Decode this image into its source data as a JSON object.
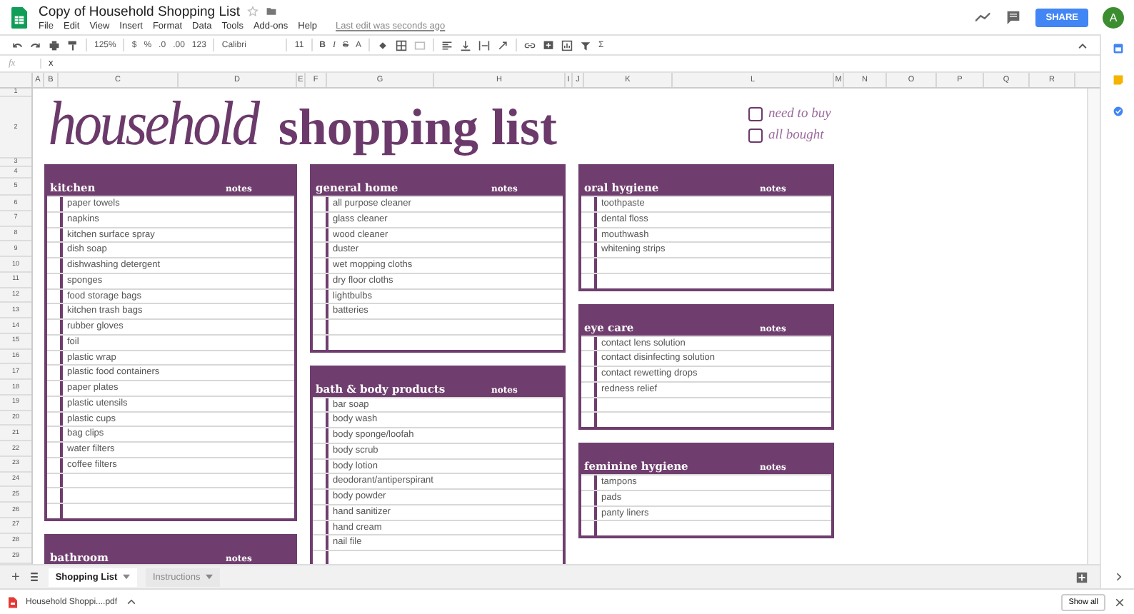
{
  "document": {
    "title": "Copy of Household Shopping List",
    "menu": [
      "File",
      "Edit",
      "View",
      "Insert",
      "Format",
      "Data",
      "Tools",
      "Add-ons",
      "Help"
    ],
    "last_edit": "Last edit was seconds ago"
  },
  "header_actions": {
    "share": "SHARE",
    "avatar": "A"
  },
  "toolbar": {
    "zoom": "125%",
    "currency": "$",
    "percent": "%",
    "decrease_decimals": ".0",
    "increase_decimals": ".00",
    "number_format": "123",
    "font": "Calibri",
    "font_size": "11",
    "format_buttons": [
      "B",
      "I",
      "S",
      "A"
    ],
    "sum": "Σ"
  },
  "formula_bar": {
    "label": "fx",
    "value": "x"
  },
  "column_headers": [
    "A",
    "B",
    "C",
    "D",
    "E",
    "F",
    "G",
    "H",
    "I",
    "J",
    "K",
    "L",
    "M",
    "N",
    "O",
    "P",
    "Q",
    "R"
  ],
  "row_headers": [
    "1",
    "2",
    "3",
    "4",
    "5",
    "6",
    "7",
    "8",
    "9",
    "10",
    "11",
    "12",
    "13",
    "14",
    "15",
    "16",
    "17",
    "18",
    "19",
    "20",
    "21",
    "22",
    "23",
    "24",
    "25",
    "26",
    "27",
    "28",
    "29"
  ],
  "sheet": {
    "title_script": "household",
    "title_bold": "shopping list",
    "legend": [
      {
        "label": "need to buy"
      },
      {
        "label": "all bought"
      }
    ],
    "columns": [
      [
        {
          "title": "kitchen",
          "notes": "notes",
          "items": [
            {
              "text": "paper towels",
              "checked": false
            },
            {
              "text": "napkins",
              "checked": false
            },
            {
              "text": "kitchen surface spray",
              "checked": false
            },
            {
              "text": "dish soap",
              "checked": false
            },
            {
              "text": "dishwashing detergent",
              "checked": false
            },
            {
              "text": "sponges",
              "checked": false
            },
            {
              "text": "food storage bags",
              "checked": false
            },
            {
              "text": "kitchen trash bags",
              "checked": false
            },
            {
              "text": "rubber gloves",
              "checked": false
            },
            {
              "text": "foil",
              "checked": false
            },
            {
              "text": "plastic wrap",
              "checked": false
            },
            {
              "text": "plastic food containers",
              "checked": false
            },
            {
              "text": "paper plates",
              "checked": false
            },
            {
              "text": "plastic utensils",
              "checked": false
            },
            {
              "text": "plastic cups",
              "checked": false
            },
            {
              "text": "bag clips",
              "checked": false
            },
            {
              "text": "water filters",
              "checked": false
            },
            {
              "text": "coffee filters",
              "checked": false
            },
            {
              "checked": false
            },
            {
              "checked": false
            },
            {
              "checked": false
            }
          ]
        },
        {
          "title": "bathroom",
          "notes": "notes"
        }
      ],
      [
        {
          "title": "general home",
          "notes": "notes",
          "items": [
            {
              "text": "all purpose cleaner",
              "checked": false
            },
            {
              "text": "glass cleaner",
              "checked": false
            },
            {
              "text": "wood cleaner",
              "checked": false
            },
            {
              "text": "duster",
              "checked": false
            },
            {
              "text": "wet mopping cloths",
              "checked": false
            },
            {
              "text": "dry floor cloths",
              "checked": false
            },
            {
              "text": "lightbulbs",
              "checked": false
            },
            {
              "text": "batteries",
              "checked": false
            },
            {
              "checked": false
            },
            {
              "checked": false
            }
          ]
        },
        {
          "title": "bath & body products",
          "notes": "notes",
          "items": [
            {
              "text": "bar soap",
              "checked": false
            },
            {
              "text": "body wash",
              "checked": false
            },
            {
              "text": "body sponge/loofah",
              "checked": false
            },
            {
              "text": "body scrub",
              "checked": false
            },
            {
              "text": "body lotion",
              "checked": false
            },
            {
              "text": "deodorant/antiperspirant",
              "checked": false
            },
            {
              "text": "body powder",
              "checked": false
            },
            {
              "text": "hand sanitizer",
              "checked": false
            },
            {
              "text": "hand cream",
              "checked": false
            },
            {
              "text": "nail file",
              "checked": false
            },
            {
              "checked": false
            }
          ]
        }
      ],
      [
        {
          "title": "oral hygiene",
          "notes": "notes",
          "items": [
            {
              "text": "toothpaste",
              "checked": false
            },
            {
              "text": "dental floss",
              "checked": false
            },
            {
              "text": "mouthwash",
              "checked": false
            },
            {
              "text": "whitening strips",
              "checked": false
            },
            {
              "checked": false
            },
            {
              "checked": false
            }
          ]
        },
        {
          "title": "eye care",
          "notes": "notes",
          "items": [
            {
              "text": "contact lens solution",
              "checked": false
            },
            {
              "text": "contact disinfecting solution",
              "checked": false
            },
            {
              "text": "contact rewetting drops",
              "checked": false
            },
            {
              "text": "redness relief",
              "checked": false
            },
            {
              "checked": false
            },
            {
              "checked": false
            }
          ]
        },
        {
          "title": "feminine hygiene",
          "notes": "notes",
          "items": [
            {
              "text": "tampons",
              "checked": false
            },
            {
              "text": "pads",
              "checked": false
            },
            {
              "text": "panty liners",
              "checked": false
            },
            {
              "checked": false
            }
          ]
        }
      ]
    ]
  },
  "add_sheet": "+",
  "sheet_tabs": [
    {
      "label": "Shopping List",
      "selected": true
    },
    {
      "label": "Instructions",
      "selected": false
    }
  ],
  "download_bar": {
    "file": "Household Shoppi....pdf",
    "show_all": "Show all"
  }
}
